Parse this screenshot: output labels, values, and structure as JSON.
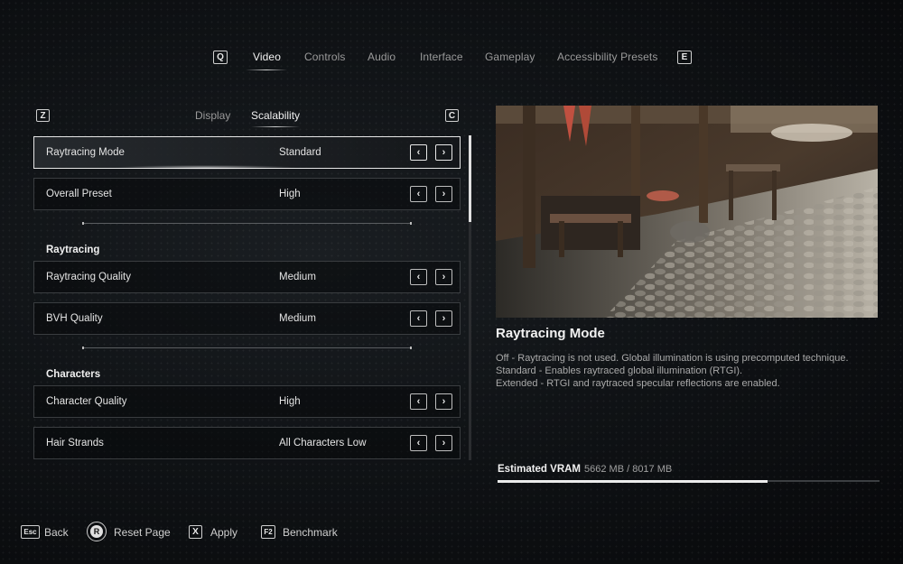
{
  "top_nav": {
    "left_key": "Q",
    "right_key": "E",
    "tabs": [
      {
        "label": "Video",
        "active": true
      },
      {
        "label": "Controls",
        "active": false
      },
      {
        "label": "Audio",
        "active": false
      },
      {
        "label": "Interface",
        "active": false
      },
      {
        "label": "Gameplay",
        "active": false
      },
      {
        "label": "Accessibility Presets",
        "active": false
      }
    ]
  },
  "sub_nav": {
    "left_key": "Z",
    "right_key": "C",
    "tabs": [
      {
        "label": "Display",
        "active": false
      },
      {
        "label": "Scalability",
        "active": true
      }
    ]
  },
  "settings": {
    "rows": [
      {
        "label": "Raytracing Mode",
        "value": "Standard",
        "selected": true
      },
      {
        "label": "Overall Preset",
        "value": "High"
      },
      {
        "label": "Raytracing Quality",
        "value": "Medium"
      },
      {
        "label": "BVH Quality",
        "value": "Medium"
      },
      {
        "label": "Character Quality",
        "value": "High"
      },
      {
        "label": "Hair Strands",
        "value": "All Characters Low"
      }
    ],
    "sections": {
      "raytracing": "Raytracing",
      "characters": "Characters"
    },
    "arrow_left": "‹",
    "arrow_right": "›"
  },
  "info": {
    "title": "Raytracing Mode",
    "lines": [
      "Off - Raytracing is not used. Global illumination is using precomputed technique.",
      "Standard - Enables raytraced global illumination (RTGI).",
      "Extended - RTGI and raytraced specular reflections are enabled."
    ]
  },
  "vram": {
    "label": "Estimated VRAM",
    "value": "5662 MB / 8017 MB",
    "fraction": 0.706
  },
  "footer": {
    "back": {
      "key": "Esc",
      "label": "Back"
    },
    "reset": {
      "key": "R",
      "label": "Reset Page"
    },
    "apply": {
      "key": "X",
      "label": "Apply"
    },
    "benchmark": {
      "key": "F2",
      "label": "Benchmark"
    }
  }
}
